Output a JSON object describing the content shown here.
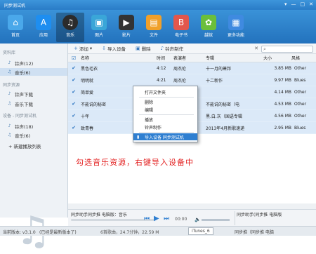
{
  "window": {
    "title": "同步测试机",
    "controls": [
      "▾",
      "—",
      "□",
      "✕"
    ]
  },
  "toolbar": {
    "items": [
      {
        "label": "首页",
        "icon": "home-icon",
        "color": "#4aa8ea",
        "glyph": "⌂"
      },
      {
        "label": "应用",
        "icon": "apps-icon",
        "color": "#1e8ef0",
        "glyph": "A"
      },
      {
        "label": "音乐",
        "icon": "music-icon",
        "color": "#2b2b2b",
        "glyph": "♫"
      },
      {
        "label": "图片",
        "icon": "pictures-icon",
        "color": "#3aa6d8",
        "glyph": "▣"
      },
      {
        "label": "影片",
        "icon": "movies-icon",
        "color": "#333333",
        "glyph": "▶"
      },
      {
        "label": "文件",
        "icon": "files-icon",
        "color": "#f0a02a",
        "glyph": "▤"
      },
      {
        "label": "电子书",
        "icon": "ebook-icon",
        "color": "#e2574c",
        "glyph": "B"
      },
      {
        "label": "越狱",
        "icon": "jailbreak-icon",
        "color": "#6bbf3b",
        "glyph": "✿"
      },
      {
        "label": "更多功能",
        "icon": "more-icon",
        "color": "#3f8ae0",
        "glyph": "▦"
      }
    ],
    "active_index": 2
  },
  "sidebar": {
    "section_library": "资料库",
    "items_library": [
      {
        "label": "铃声(12)",
        "icon": "bell-icon"
      },
      {
        "label": "音乐(6)",
        "icon": "music-note-icon",
        "selected": true
      }
    ],
    "section_sync": "同步资源",
    "items_sync": [
      {
        "label": "铃声下载",
        "icon": "bell-icon"
      },
      {
        "label": "音乐下载",
        "icon": "music-note-icon"
      }
    ],
    "section_device": "设备 - 同步测试机",
    "items_device": [
      {
        "label": "铃声(18)",
        "icon": "bell-icon"
      },
      {
        "label": "音乐(6)",
        "icon": "music-note-icon"
      }
    ],
    "new_playlist": "+ 新建播放列表"
  },
  "actions": {
    "add": "添加",
    "import": "导入设备",
    "delete": "删除",
    "ringtone": "铃声制作",
    "search_placeholder": ""
  },
  "table": {
    "headers": [
      "名称",
      "时间",
      "表演者",
      "专辑",
      "大小",
      "风格"
    ],
    "rows": [
      {
        "name": "黑色毛衣",
        "time": "4:12",
        "artist": "周杰伦",
        "album": "十一月的萧邦",
        "size": "3.85 MB",
        "genre": "Other"
      },
      {
        "name": "明明就",
        "time": "4:21",
        "artist": "周杰伦",
        "album": "十二新作",
        "size": "9.97 MB",
        "genre": "Blues"
      },
      {
        "name": "简单爱",
        "time": "",
        "artist": "",
        "album": "",
        "size": "4.14 MB",
        "genre": "Other"
      },
      {
        "name": "不能说的秘密",
        "time": "",
        "artist": "",
        "album": "不能说的秘密（电",
        "size": "4.53 MB",
        "genre": "Other"
      },
      {
        "name": "十年",
        "time": "",
        "artist": "",
        "album": "黑.白.灰（国语专辑",
        "size": "4.56 MB",
        "genre": "Other"
      },
      {
        "name": "致青春",
        "time": "",
        "artist": "",
        "album": "2013年4月新歌速递",
        "size": "2.95 MB",
        "genre": "Blues"
      }
    ]
  },
  "context_menu": {
    "items": [
      "打开文件夹",
      "删除",
      "编辑",
      "播放",
      "铃声制作",
      "导入设备 同步测试机"
    ],
    "highlight_index": 5
  },
  "annotation": "勾选音乐资源，右键导入设备中",
  "player": {
    "track_label": "同步助手同步推 电脑版：音乐",
    "time_label": "00:00",
    "right_label": "同步助手(同步推 电脑版"
  },
  "status": {
    "version": "当前版本: v3.1.0",
    "update_note": "(已经是最新版本了)",
    "info": "6首歌曲，24.7分钟，22.59 M",
    "itunes_tab": "iTunes_6",
    "right_text": "同步推（同步推 电脑"
  }
}
